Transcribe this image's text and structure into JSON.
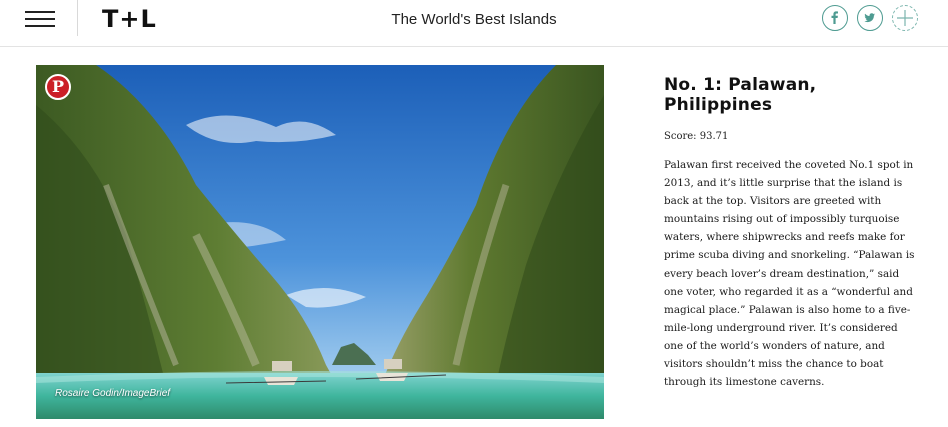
{
  "header": {
    "logo": "T+L",
    "title": "The World's Best Islands",
    "icons": [
      "menu-icon",
      "facebook-icon",
      "twitter-icon",
      "plus-icon"
    ]
  },
  "hero": {
    "credit": "Rosaire Godin/ImageBrief",
    "pin_label": "P"
  },
  "article": {
    "heading": "No. 1: Palawan, Philippines",
    "score": "Score: 93.71",
    "body": "Palawan first received the coveted No.1 spot in 2013, and it’s little surprise that the island is back at the top. Visitors are greeted with mountains rising out of impossibly turquoise waters, where shipwrecks and reefs make for prime scuba diving and snorkeling. “Palawan is every beach lover’s dream destination,” said one voter, who regarded it as a “wonderful and magical place.” Palawan is also home to a five-mile-long underground river. It’s considered one of the world’s wonders of nature, and visitors shouldn’t miss the chance to boat through its limestone caverns."
  },
  "colors": {
    "social_teal": "#4e9b91",
    "pinterest_red": "#cb1f27"
  }
}
